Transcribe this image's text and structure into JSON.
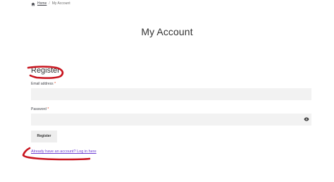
{
  "breadcrumb": {
    "icon": "home-icon",
    "home_label": "Home",
    "separator": "/",
    "current_label": "My Account"
  },
  "page": {
    "title": "My Account"
  },
  "register_form": {
    "heading": "Register",
    "email_label": "Email address",
    "password_label": "Password",
    "required_marker": "*",
    "email_value": "",
    "password_value": "",
    "password_toggle_icon": "eye-icon",
    "submit_label": "Register",
    "login_link_label": "Already have an account? Log in here"
  },
  "colors": {
    "annotation": "#c8141e",
    "link": "#6a3bd1",
    "required": "#e2401c",
    "input_bg": "#f2f2f2"
  }
}
